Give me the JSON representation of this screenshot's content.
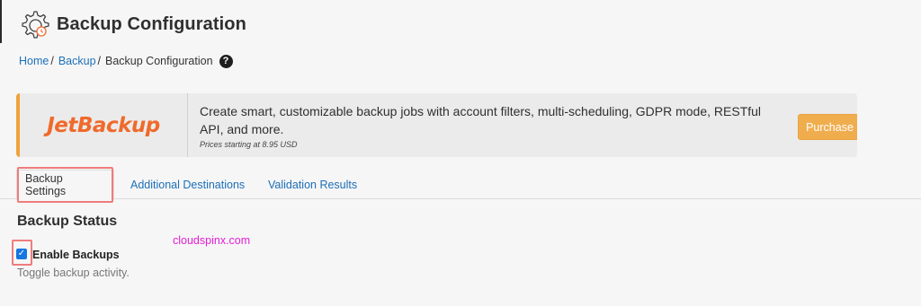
{
  "header": {
    "title": "Backup Configuration",
    "icon": "backup-gear-icon"
  },
  "breadcrumb": {
    "items": [
      "Home",
      "Backup",
      "Backup Configuration"
    ],
    "separator": "/",
    "help_icon": "question-circle-icon",
    "help_glyph": "?"
  },
  "promo": {
    "logo_text": "JetBackup",
    "description": "Create smart, customizable backup jobs with account filters, multi-scheduling, GDPR mode, RESTful API, and more.",
    "price_note": "Prices starting at 8.95 USD",
    "button_label": "Purchase",
    "accent_color": "#f0a33d",
    "logo_color": "#ef6a2b"
  },
  "tabs": [
    {
      "label": "Backup Settings",
      "active": true
    },
    {
      "label": "Additional Destinations",
      "active": false
    },
    {
      "label": "Validation Results",
      "active": false
    }
  ],
  "section": {
    "title": "Backup Status",
    "watermark": "cloudspinx.com",
    "enable_label": "Enable Backups",
    "enable_checked": true,
    "enable_help": "Toggle backup activity.",
    "check_glyph": "✓"
  },
  "colors": {
    "link": "#1d6fb8",
    "highlight": "#ef7c7c",
    "checkbox": "#1676e0",
    "watermark": "#e41fd6"
  }
}
